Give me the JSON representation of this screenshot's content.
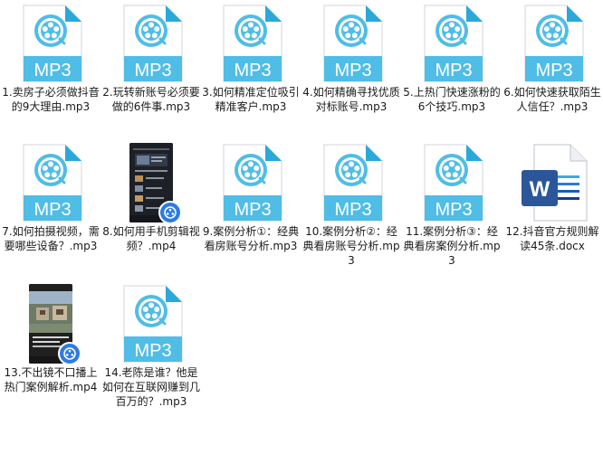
{
  "icon_badge_text": "MP3",
  "colors": {
    "mp3_fold": "#29a8da",
    "mp3_band": "#4fbde6",
    "page_border": "#d9dde2",
    "word_blue": "#2b579a",
    "video_badge": "#2c7be5"
  },
  "files": [
    {
      "name": "1.卖房子必须做抖音的9大理由.mp3",
      "type": "mp3",
      "icon": "audio-file-icon"
    },
    {
      "name": "2.玩转新账号必须要做的6件事.mp3",
      "type": "mp3",
      "icon": "audio-file-icon"
    },
    {
      "name": "3.如何精准定位吸引精准客户.mp3",
      "type": "mp3",
      "icon": "audio-file-icon"
    },
    {
      "name": "4.如何精确寻找优质对标账号.mp3",
      "type": "mp3",
      "icon": "audio-file-icon"
    },
    {
      "name": "5.上热门快速涨粉的6个技巧.mp3",
      "type": "mp3",
      "icon": "audio-file-icon"
    },
    {
      "name": "6.如何快速获取陌生人信任？.mp3",
      "type": "mp3",
      "icon": "audio-file-icon"
    },
    {
      "name": "7.如何拍摄视频，需要哪些设备？.mp3",
      "type": "mp3",
      "icon": "audio-file-icon"
    },
    {
      "name": "8.如何用手机剪辑视频？.mp4",
      "type": "mp4",
      "icon": "video-thumbnail-icon"
    },
    {
      "name": "9.案例分析①：经典看房账号分析.mp3",
      "type": "mp3",
      "icon": "audio-file-icon"
    },
    {
      "name": "10.案例分析②：经典看房账号分析.mp3",
      "type": "mp3",
      "icon": "audio-file-icon"
    },
    {
      "name": "11.案例分析③：经典看房案例分析.mp3",
      "type": "mp3",
      "icon": "audio-file-icon"
    },
    {
      "name": "12.抖音官方规则解读45条.docx",
      "type": "docx",
      "icon": "word-document-icon"
    },
    {
      "name": "13.不出镜不口播上热门案例解析.mp4",
      "type": "mp4",
      "icon": "video-thumbnail-icon"
    },
    {
      "name": "14.老陈是谁？他是如何在互联网赚到几百万的？.mp3",
      "type": "mp3",
      "icon": "audio-file-icon"
    }
  ]
}
